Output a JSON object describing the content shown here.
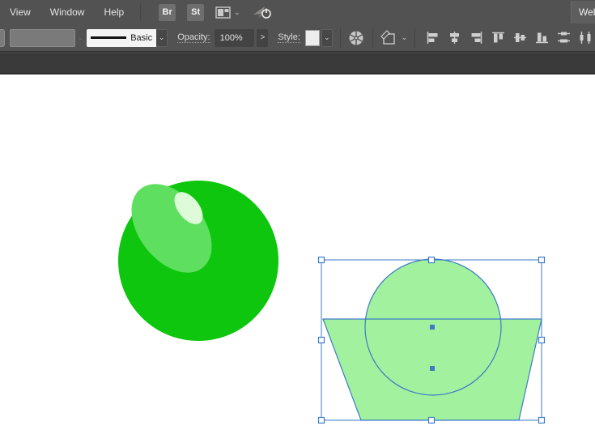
{
  "menubar": {
    "items": [
      "View",
      "Window",
      "Help"
    ],
    "br_button": "Br",
    "st_button": "St",
    "workspace_label": "Web",
    "icons": [
      "arrange-documents-icon",
      "chevron-down-icon",
      "gpu-performance-icon"
    ]
  },
  "control_bar": {
    "brush_definition": "Basic",
    "opacity_label": "Opacity:",
    "opacity_value": "100%",
    "more_options_label": ">",
    "style_label": "Style:",
    "icons": [
      "recolor-artwork-icon",
      "object-options-icon",
      "align-left-icon",
      "align-horizontal-center-icon",
      "align-right-icon",
      "align-top-icon",
      "align-vertical-center-icon",
      "align-bottom-icon",
      "distribute-vertical-center-icon",
      "distribute-horizontal-center-icon"
    ]
  },
  "canvas": {
    "ball": {
      "body_color": "#0dc60d",
      "highlight_color": "#5fdf5f",
      "highlight_inner_color": "#defbd9"
    },
    "selection": {
      "fill_color": "#a2f19e",
      "outline_color": "#3d7bc6",
      "handle_fill": "#ffffff",
      "objects": [
        "circle",
        "trapezoid"
      ],
      "handle_count": 8,
      "center_point_count": 2
    }
  },
  "colors": {
    "bar_background": "#525252",
    "tabbar_background": "#3a3a3a",
    "field_background": "#434343",
    "selection_blue": "#3d7bc6",
    "canvas_white": "#ffffff"
  }
}
